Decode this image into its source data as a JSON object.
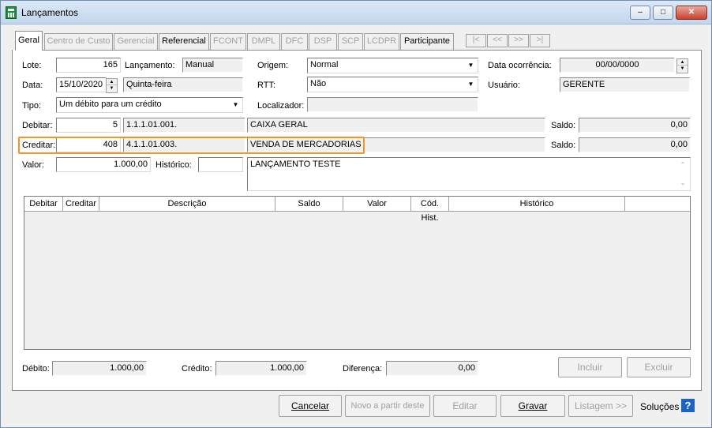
{
  "window": {
    "title": "Lançamentos",
    "minimize": "–",
    "restore": "□",
    "close": "✕"
  },
  "tabs": [
    {
      "label": "Geral",
      "active": true
    },
    {
      "label": "Centro de Custo"
    },
    {
      "label": "Gerencial"
    },
    {
      "label": "Referencial"
    },
    {
      "label": "FCONT"
    },
    {
      "label": "DMPL"
    },
    {
      "label": "DFC"
    },
    {
      "label": "DSP"
    },
    {
      "label": "SCP"
    },
    {
      "label": "LCDPR"
    },
    {
      "label": "Participante"
    }
  ],
  "nav": {
    "first": "|<",
    "prev": "<<",
    "next": ">>",
    "last": ">|"
  },
  "form": {
    "lote_label": "Lote:",
    "lote": "165",
    "lancamento_label": "Lançamento:",
    "lancamento": "Manual",
    "origem_label": "Origem:",
    "origem": "Normal",
    "data_ocorrencia_label": "Data ocorrência:",
    "data_ocorrencia": "00/00/0000",
    "data_label": "Data:",
    "data": "15/10/2020",
    "dia_semana": "Quinta-feira",
    "rtt_label": "RTT:",
    "rtt": "Não",
    "usuario_label": "Usuário:",
    "usuario": "GERENTE",
    "tipo_label": "Tipo:",
    "tipo": "Um débito para um crédito",
    "localizador_label": "Localizador:",
    "localizador": "",
    "debitar_label": "Debitar:",
    "debitar": "5",
    "debitar_conta": "1.1.1.01.001.",
    "debitar_nome": "CAIXA GERAL",
    "saldo_label": "Saldo:",
    "saldo_debito": "0,00",
    "creditar_label": "Creditar:",
    "creditar": "408",
    "creditar_conta": "4.1.1.01.003.",
    "creditar_nome": "VENDA DE MERCADORIAS",
    "saldo_credito": "0,00",
    "valor_label": "Valor:",
    "valor": "1.000,00",
    "historico_label": "Histórico:",
    "historico_codigo": "",
    "historico_texto": "LANÇAMENTO TESTE"
  },
  "grid": {
    "columns": [
      "Debitar",
      "Creditar",
      "Descrição",
      "Saldo",
      "Valor",
      "Cód. Hist.",
      "Histórico"
    ],
    "rows": []
  },
  "totals": {
    "debito_label": "Débito:",
    "debito": "1.000,00",
    "credito_label": "Crédito:",
    "credito": "1.000,00",
    "diferenca_label": "Diferença:",
    "diferenca": "0,00",
    "incluir": "Incluir",
    "excluir": "Excluir"
  },
  "footer": {
    "cancelar": "Cancelar",
    "novo": "Novo a partir deste",
    "editar": "Editar",
    "gravar": "Gravar",
    "listagem": "Listagem >>",
    "solucoes": "Soluções",
    "help": "?"
  },
  "colors": {
    "highlight": "#f2932c",
    "title_bg": "#c3d6ec",
    "help_icon": "#1d63c4"
  }
}
